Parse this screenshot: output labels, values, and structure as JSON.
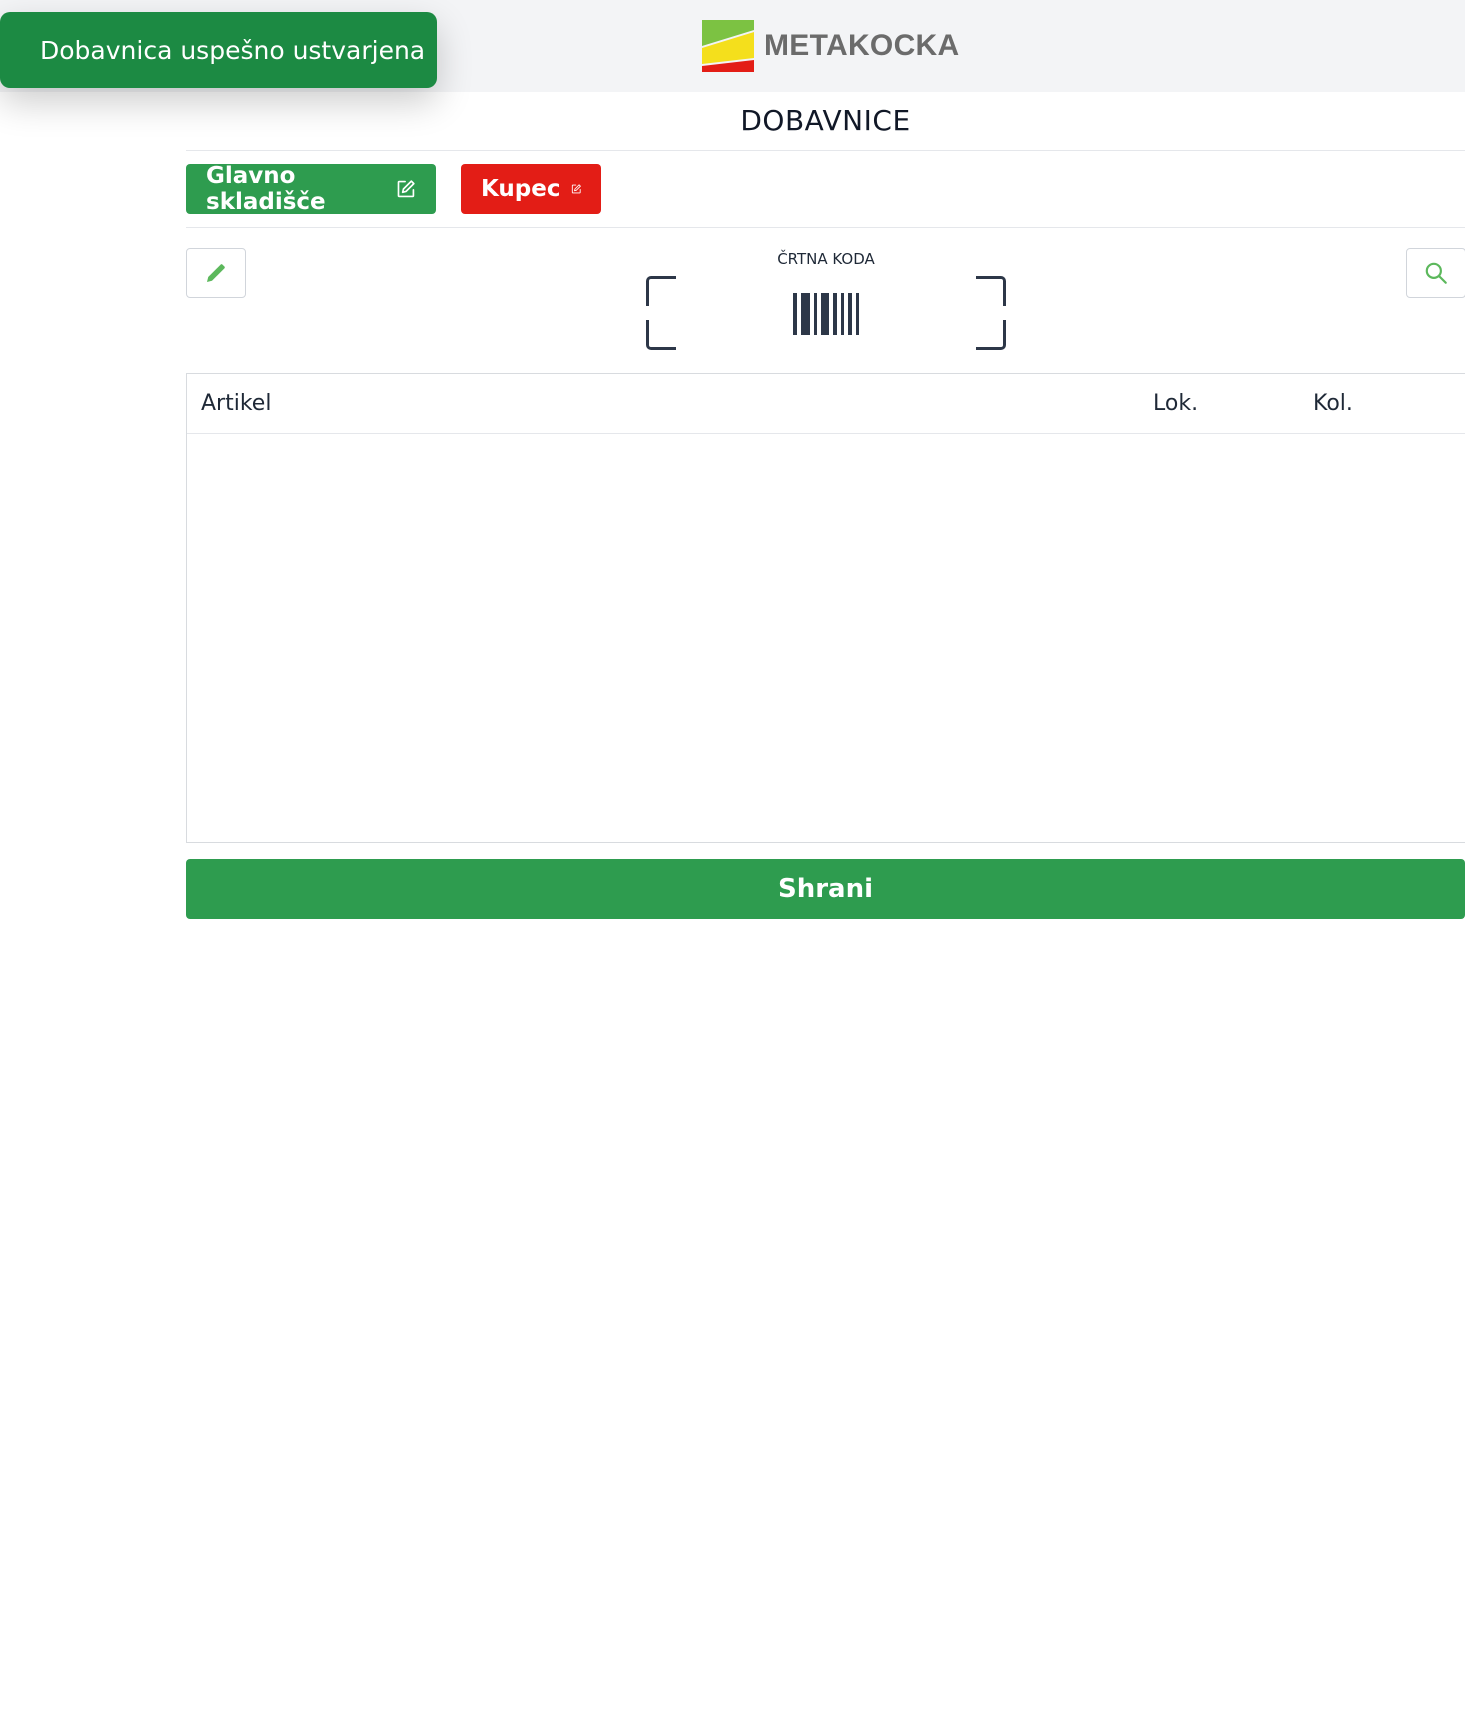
{
  "toast": {
    "message": "Dobavnica uspešno ustvarjena"
  },
  "header": {
    "logo_text": "METAKOCKA",
    "logo_icon": "metakocka-logo-icon"
  },
  "page": {
    "title": "DOBAVNICE"
  },
  "tags": {
    "warehouse_label": "Glavno skladišče",
    "customer_label": "Kupec",
    "edit_icon": "edit-icon"
  },
  "tools": {
    "pencil_icon": "pencil-icon",
    "search_icon": "search-icon"
  },
  "scanner": {
    "label": "ČRTNA KODA",
    "icon": "barcode-icon"
  },
  "table": {
    "columns": [
      "Artikel",
      "Lok.",
      "Kol."
    ],
    "rows": []
  },
  "actions": {
    "save_label": "Shrani"
  },
  "colors": {
    "success_green": "#2e9c4f",
    "toast_green": "#1c8a43",
    "danger_red": "#e31d16",
    "header_bg": "#f3f4f6",
    "icon_green": "#5cb85c"
  }
}
